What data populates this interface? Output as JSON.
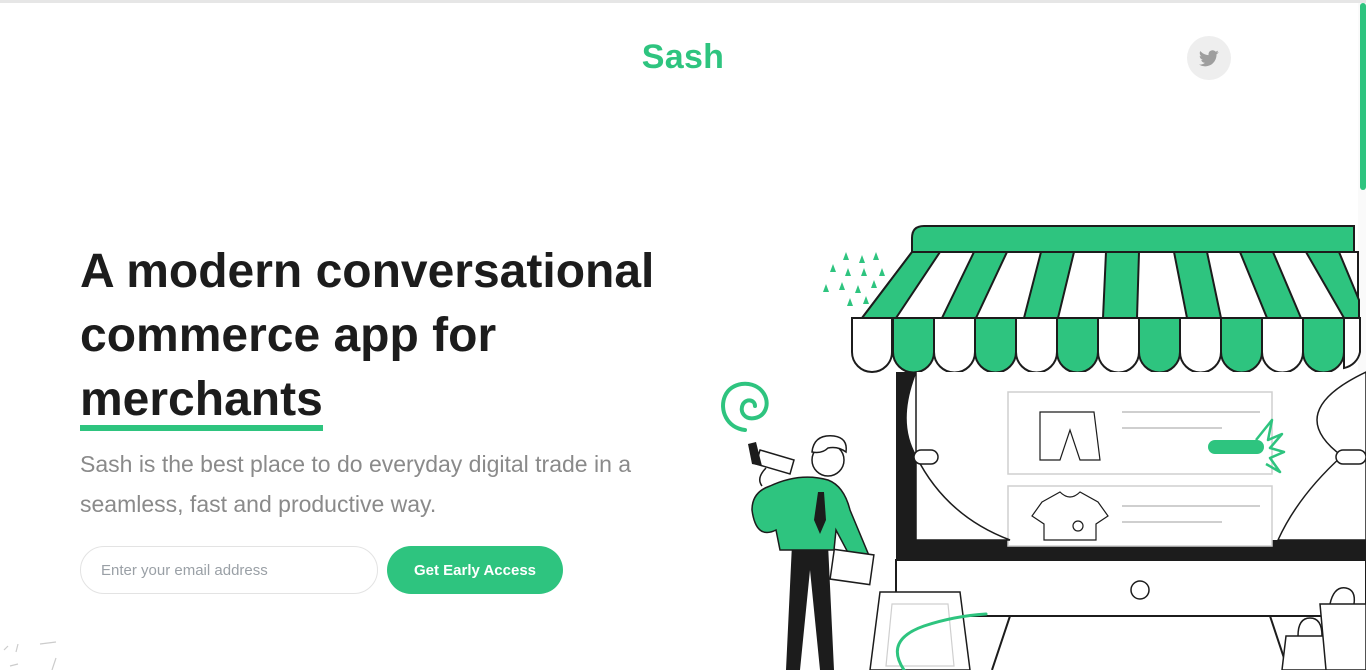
{
  "header": {
    "logo": "Sash",
    "social": {
      "icon": "twitter-icon"
    }
  },
  "hero": {
    "headline_line1": "A modern conversational",
    "headline_line2": "commerce app for",
    "headline_highlight": "merchants",
    "subtext": "Sash is the best place to do everyday digital trade in a seamless, fast and productive way.",
    "email_placeholder": "Enter your email address",
    "cta_label": "Get Early Access"
  },
  "illustration": {
    "name": "storefront-with-person-megaphone",
    "icons": [
      "storefront-awning",
      "megaphone-icon",
      "shopping-bag-icon",
      "shorts-icon",
      "tshirt-icon"
    ]
  },
  "colors": {
    "accent": "#2ec47f",
    "text_dark": "#1c1c1c",
    "text_muted": "#8a8a8a",
    "twitter_bg": "#eeeeee"
  }
}
